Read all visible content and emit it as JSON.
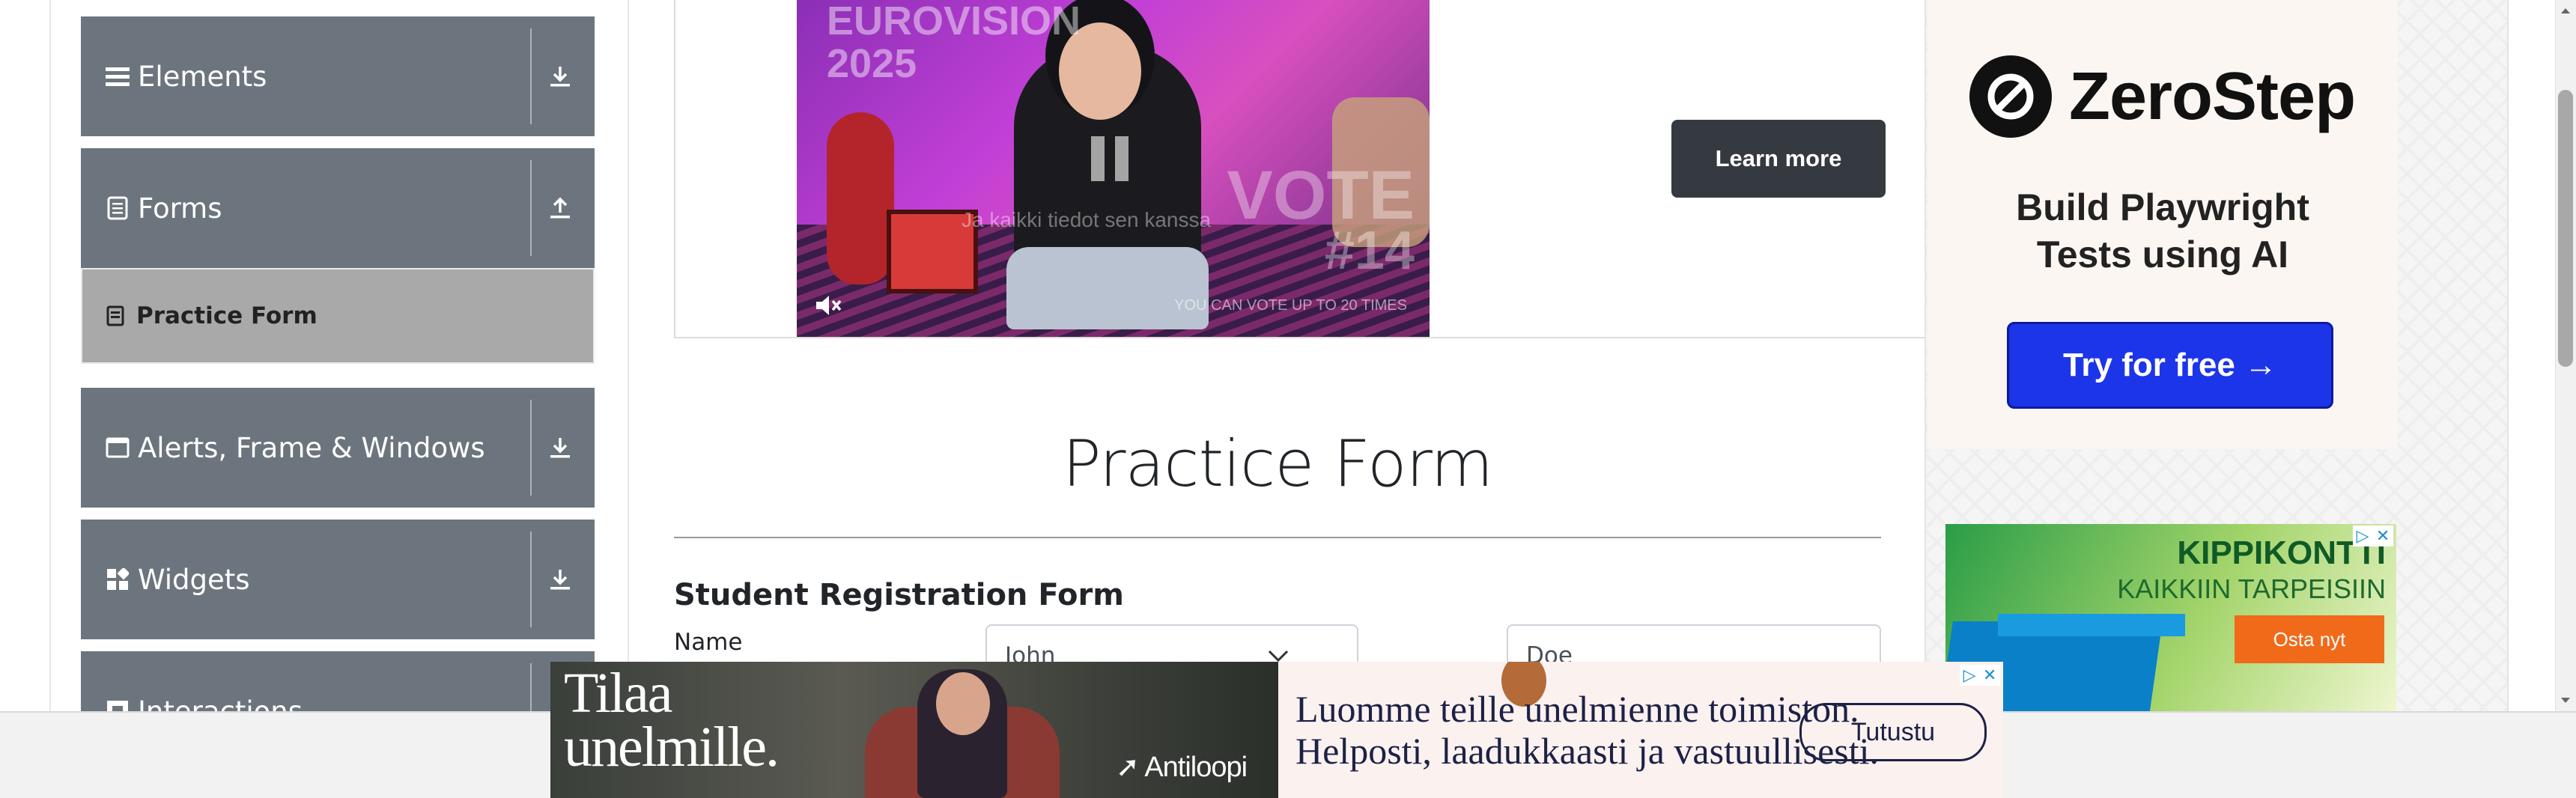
{
  "sidebar": {
    "groups": [
      {
        "label": "Elements",
        "icon": "hamburger-icon",
        "arrow": "download-icon"
      },
      {
        "label": "Forms",
        "icon": "document-icon",
        "arrow": "upload-icon"
      },
      {
        "label": "Alerts, Frame & Windows",
        "icon": "window-icon",
        "arrow": "download-icon"
      },
      {
        "label": "Widgets",
        "icon": "widgets-icon",
        "arrow": "download-icon"
      },
      {
        "label": "Interactions",
        "icon": "interactions-icon",
        "arrow": "download-icon"
      }
    ],
    "subitems": [
      {
        "label": "Practice Form",
        "icon": "form-icon",
        "active": true
      }
    ]
  },
  "video_ad": {
    "brand_line1": "EUROVISION",
    "brand_line2": "2025",
    "vote_line1": "VOTE",
    "vote_line2": "#14",
    "caption": "Ja kaikki tiedot sen kanssa",
    "bottom_text": "YOU CAN VOTE UP TO 20 TIMES",
    "learn_more": "Learn more"
  },
  "form": {
    "title": "Practice Form",
    "subtitle": "Student Registration Form",
    "name_label": "Name",
    "first_name_value": "John",
    "last_name_value": "Doe"
  },
  "zerostep_ad": {
    "name": "ZeroStep",
    "tagline_line1": "Build Playwright",
    "tagline_line2": "Tests using AI",
    "cta": "Try for free →"
  },
  "kippikontti_ad": {
    "title": "KIPPIKONTTI",
    "subtitle": "KAIKKIIN TARPEISIIN",
    "cta": "Osta nyt"
  },
  "bottom_banner": {
    "headline_line1": "Tilaa",
    "headline_line2": "unelmille.",
    "brand": "Antiloopi",
    "text_line1": "Luomme teille unelmienne toimiston.",
    "text_line2": "Helposti, laadukkaasti ja vastuullisesti.",
    "cta": "Tutustu"
  },
  "colors": {
    "sidebar_group_bg": "#6c757d",
    "sidebar_active_bg": "#a9a9a9",
    "learn_more_bg": "#343a40",
    "zerostep_cta_bg": "#1d35e8",
    "kippikontti_cta_bg": "#f06a1a"
  }
}
